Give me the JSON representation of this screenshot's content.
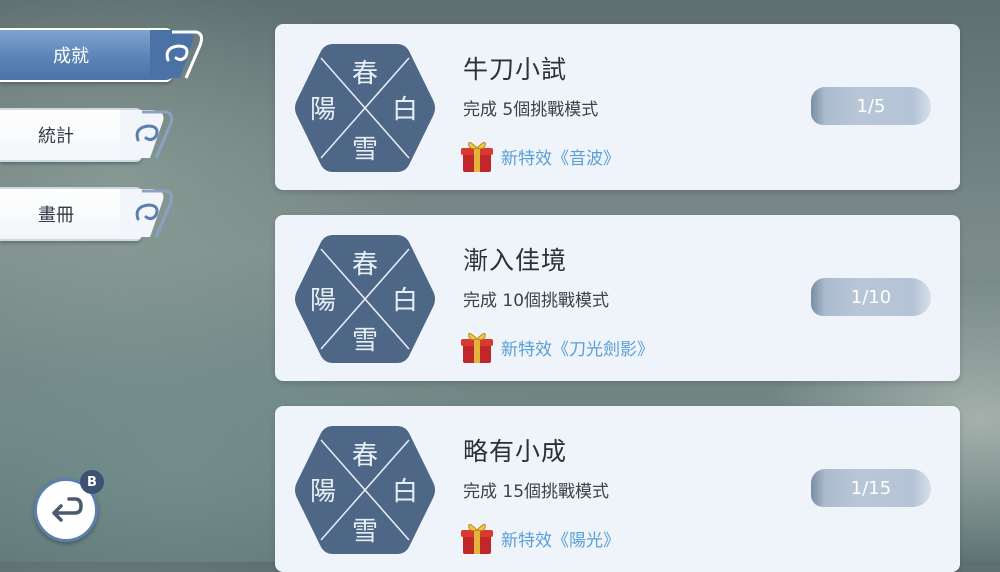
{
  "menu": {
    "items": [
      {
        "label": "成就",
        "active": true
      },
      {
        "label": "統計",
        "active": false
      },
      {
        "label": "畫冊",
        "active": false
      }
    ]
  },
  "back": {
    "badge": "B",
    "icon": "return-arrow-icon"
  },
  "emblem": {
    "top": "春",
    "left": "陽",
    "right": "白",
    "bottom": "雪"
  },
  "achievements": [
    {
      "title": "牛刀小試",
      "desc": "完成 5個挑戰模式",
      "reward": "新特效《音波》",
      "progress": "1/5"
    },
    {
      "title": "漸入佳境",
      "desc": "完成 10個挑戰模式",
      "reward": "新特效《刀光劍影》",
      "progress": "1/10"
    },
    {
      "title": "略有小成",
      "desc": "完成 15個挑戰模式",
      "reward": "新特效《陽光》",
      "progress": "1/15"
    }
  ],
  "colors": {
    "accent": "#5b84b7",
    "card_bg": "#eef4fa",
    "reward_text": "#5a9fd6",
    "emblem": "#4f6786"
  }
}
